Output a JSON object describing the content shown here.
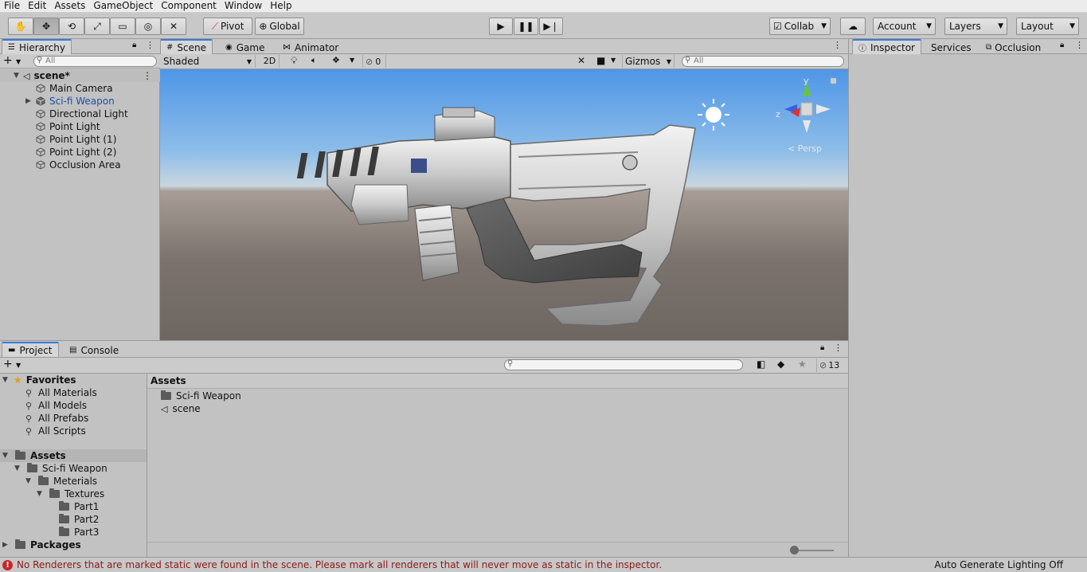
{
  "menu": [
    "File",
    "Edit",
    "Assets",
    "GameObject",
    "Component",
    "Window",
    "Help"
  ],
  "toolbar": {
    "pivot_label": "Pivot",
    "global_label": "Global",
    "collab_label": "Collab",
    "account_label": "Account",
    "layers_label": "Layers",
    "layout_label": "Layout"
  },
  "hierarchy": {
    "tab": "Hierarchy",
    "search_placeholder": "All",
    "scene_name": "scene*",
    "items": [
      "Main Camera",
      "Sci-fi Weapon",
      "Directional Light",
      "Point Light",
      "Point Light (1)",
      "Point Light (2)",
      "Occlusion Area"
    ]
  },
  "scene_tabs": {
    "scene": "Scene",
    "game": "Game",
    "animator": "Animator"
  },
  "scene_toolbar": {
    "shading": "Shaded",
    "mode_2d": "2D",
    "hidden_count": "0",
    "gizmos": "Gizmos",
    "search_placeholder": "All"
  },
  "gizmo": {
    "y": "y",
    "z": "z",
    "persp": "< Persp"
  },
  "right_tabs": {
    "inspector": "Inspector",
    "services": "Services",
    "occlusion": "Occlusion"
  },
  "project": {
    "tab": "Project",
    "console_tab": "Console",
    "hidden_count": "13",
    "favorites_label": "Favorites",
    "favorites": [
      "All Materials",
      "All Models",
      "All Prefabs",
      "All Scripts"
    ],
    "assets_label": "Assets",
    "assets_tree": {
      "weapon": "Sci-fi Weapon",
      "materials": "Meterials",
      "textures": "Textures",
      "parts": [
        "Part1",
        "Part2",
        "Part3"
      ]
    },
    "packages_label": "Packages",
    "breadcrumb": "Assets",
    "files": [
      {
        "name": "Sci-fi Weapon",
        "icon": "folder-icon"
      },
      {
        "name": "scene",
        "icon": "unity-scene-icon"
      }
    ]
  },
  "status": {
    "error_message": "No Renderers that are marked static were found in the scene. Please mark all renderers that will never move as static in the inspector.",
    "lighting": "Auto Generate Lighting Off"
  },
  "colors": {
    "accent": "#3a79d8",
    "selected_text": "#1f4fa8",
    "error": "#8b1a1a"
  }
}
